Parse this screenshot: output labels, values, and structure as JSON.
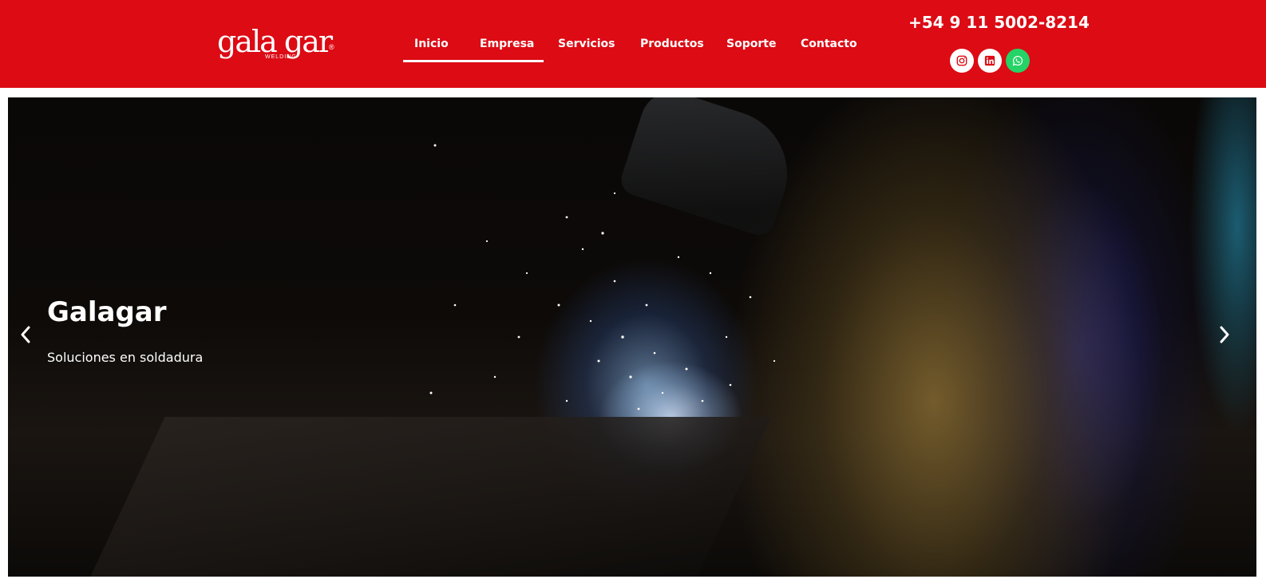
{
  "brand": {
    "logo_text": "gala gar",
    "logo_sub": "WELDING",
    "logo_mark": "®",
    "color_primary": "#dc0b14"
  },
  "nav": {
    "items": [
      {
        "label": "Inicio",
        "active": true
      },
      {
        "label": "Empresa",
        "active": false
      },
      {
        "label": "Servicios",
        "active": false
      },
      {
        "label": "Productos",
        "active": false
      },
      {
        "label": "Soporte",
        "active": false
      },
      {
        "label": "Contacto",
        "active": false
      }
    ]
  },
  "contact": {
    "phone": "+54 9 11 5002-8214",
    "social": [
      {
        "icon": "instagram-icon"
      },
      {
        "icon": "linkedin-icon"
      },
      {
        "icon": "whatsapp-icon",
        "color": "#25d366"
      }
    ]
  },
  "hero": {
    "title": "Galagar",
    "subtitle": "Soluciones en soldadura",
    "prev_icon": "chevron-left-icon",
    "next_icon": "chevron-right-icon"
  }
}
